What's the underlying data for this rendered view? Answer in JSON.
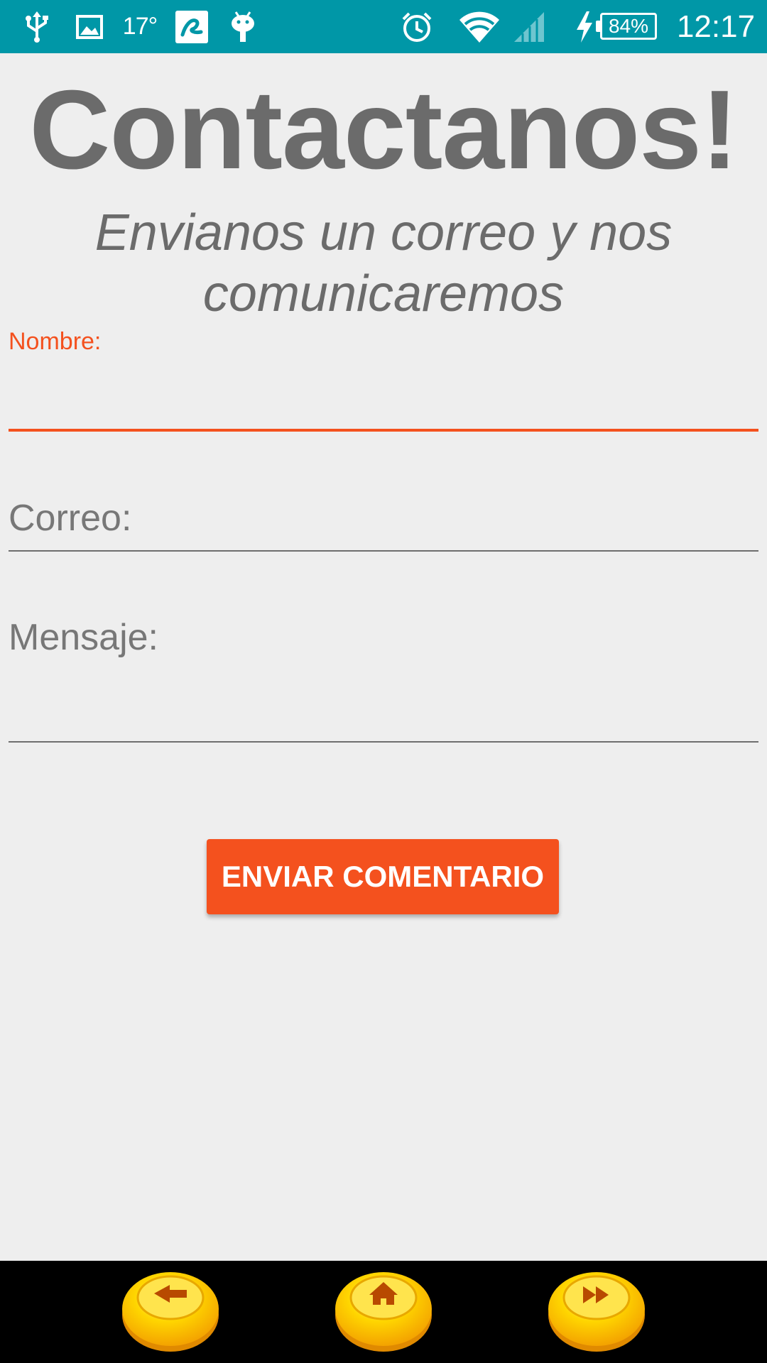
{
  "status_bar": {
    "temperature": "17°",
    "battery_percent": "84%",
    "time": "12:17",
    "icons": [
      "usb-icon",
      "image-icon",
      "weather-temp",
      "app-icon",
      "android-icon",
      "alarm-icon",
      "wifi-icon",
      "signal-icon",
      "charging-icon",
      "battery-icon"
    ]
  },
  "header": {
    "title": "Contactanos!",
    "subtitle": "Envianos un correo y nos comunicaremos"
  },
  "form": {
    "name_label": "Nombre:",
    "name_value": "",
    "email_placeholder": "Correo:",
    "email_value": "",
    "message_placeholder": "Mensaje:",
    "message_value": "",
    "submit_label": "ENVIAR COMENTARIO"
  },
  "bottom_nav": {
    "buttons": [
      "back-arrow-icon",
      "home-icon",
      "fast-forward-icon"
    ]
  },
  "colors": {
    "status_bar": "#0097a7",
    "accent": "#f4511e",
    "text_gray": "#6b6b6b",
    "background": "#eeeeee",
    "button_yellow": "#ffd600"
  }
}
